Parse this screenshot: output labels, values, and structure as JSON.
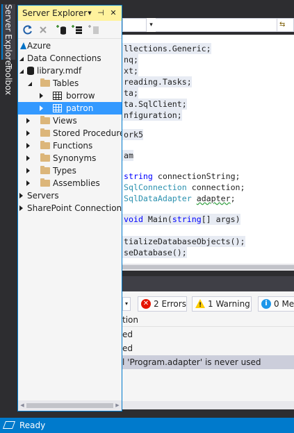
{
  "side_tabs": [
    "Server Explorer",
    "Toolbox"
  ],
  "panel": {
    "title": "Server Explorer",
    "title_buttons": [
      "▾",
      "⊣",
      "✕"
    ]
  },
  "tree": {
    "azure": "Azure",
    "data_connections": "Data Connections",
    "library": "library.mdf",
    "tables": "Tables",
    "borrow": "borrow",
    "patron": "patron",
    "views": "Views",
    "stored_procedures": "Stored Procedures",
    "functions": "Functions",
    "synonyms": "Synonyms",
    "types": "Types",
    "assemblies": "Assemblies",
    "servers": "Servers",
    "sharepoint": "SharePoint Connections"
  },
  "code": {
    "l1": "llections.Generic;",
    "l2": "nq;",
    "l3": "xt;",
    "l4": "reading.Tasks;",
    "l5": "ta;",
    "l6_pre": "ta.SqlClient;",
    "l7": "nfiguration;",
    "l8": "ork5",
    "l9": "am",
    "l10_kw": "string",
    "l10_rest": " connectionString;",
    "l11_ty": "SqlConnection",
    "l11_rest": " connection;",
    "l12_ty": "SqlDataAdapter",
    "l12_sq": "adapter",
    "l12_end": ";",
    "l13_kw": "void",
    "l13_mid": " Main(",
    "l13_kw2": "string",
    "l13_end": "[] args)",
    "l14": "tializeDatabaseObjects();",
    "l15": "seDatabase();"
  },
  "nav": {
    "drop": "▾",
    "second": "⇆"
  },
  "error_list": {
    "errors": "2 Errors",
    "warnings": "1 Warning",
    "messages": "0 Mes",
    "error_badge": "✕",
    "warning_badge": "!",
    "message_badge": "i",
    "col_header": "tion",
    "rows": [
      "ed",
      "ed",
      "l 'Program.adapter' is never used"
    ]
  },
  "status": {
    "text": "Ready"
  },
  "colors": {
    "accent": "#007acc",
    "title_active": "#fff29d",
    "selection": "#3399ff"
  }
}
